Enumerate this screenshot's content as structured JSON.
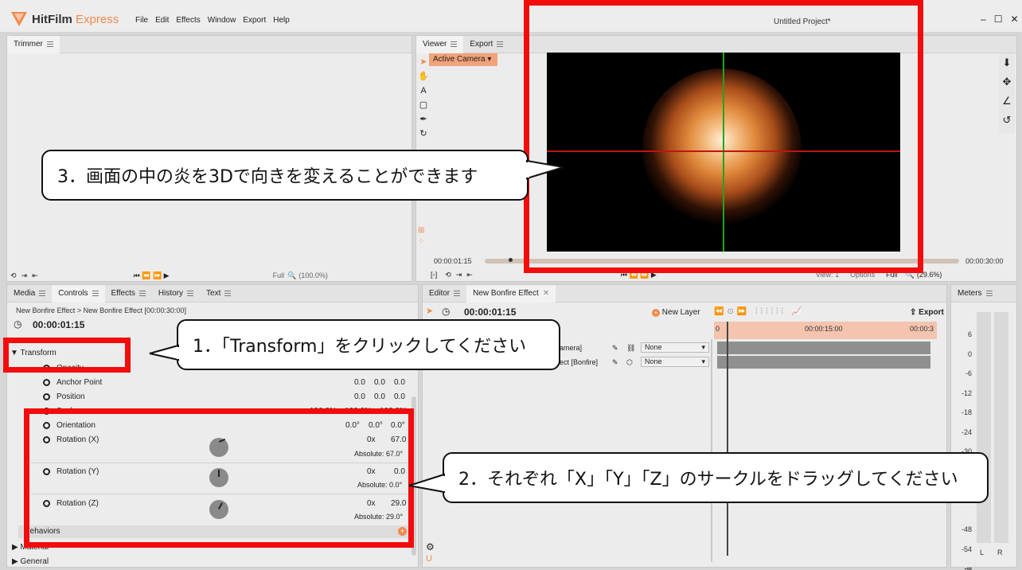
{
  "app": {
    "name": "HitFilm",
    "edition": "Express",
    "project_title": "Untitled Project*"
  },
  "menu": [
    "File",
    "Edit",
    "Effects",
    "Window",
    "Export",
    "Help"
  ],
  "window_controls": [
    "–",
    "☐",
    "✕"
  ],
  "trimmer": {
    "tab": "Trimmer",
    "zoom_mode": "Full",
    "zoom_pct": "(100.0%)"
  },
  "viewer": {
    "tabs": [
      "Viewer",
      "Export"
    ],
    "camera": "Active Camera",
    "timecode_start": "00:00:01:15",
    "timecode_end": "00:00:30:00",
    "view": "View: 1",
    "options": "Options",
    "quality": "Full",
    "zoom_pct": "(29.6%)"
  },
  "left_panel": {
    "tabs": [
      "Media",
      "Controls",
      "Effects",
      "History",
      "Text"
    ],
    "breadcrumb": "New Bonfire Effect > New Bonfire Effect [00:00:30:00]",
    "timecode": "00:00:01:15",
    "transform_label": "Transform",
    "props": {
      "opacity": "Opacity",
      "anchor": "Anchor Point",
      "anchor_vals": [
        "0.0",
        "0.0",
        "0.0"
      ],
      "position": "Position",
      "position_vals": [
        "0.0",
        "0.0",
        "0.0"
      ],
      "scale": "Scale",
      "scale_vals": [
        "100.0%",
        "100.0%",
        "100.0%"
      ],
      "orientation": "Orientation",
      "orientation_vals": [
        "0.0°",
        "0.0°",
        "0.0°"
      ],
      "rot_x": "Rotation (X)",
      "rot_x_turns": "0x",
      "rot_x_val": "67.0",
      "rot_x_abs": "Absolute: 67.0°",
      "rot_y": "Rotation (Y)",
      "rot_y_turns": "0x",
      "rot_y_val": "0.0",
      "rot_y_abs": "Absolute: 0.0°",
      "rot_z": "Rotation (Z)",
      "rot_z_turns": "0x",
      "rot_z_val": "29.0",
      "rot_z_abs": "Absolute: 29.0°"
    },
    "behaviors": "Behaviors",
    "material": "Material",
    "general": "General"
  },
  "editor": {
    "tabs": [
      "Editor",
      "New Bonfire Effect"
    ],
    "timecode": "00:00:01:15",
    "new_layer": "New Layer",
    "export": "Export",
    "ruler": [
      "0",
      "00:00:15:00",
      "00:00:3"
    ],
    "layers": [
      {
        "name": "amera]",
        "blend": "None"
      },
      {
        "name": "ect [Bonfire]",
        "blend": "None"
      }
    ]
  },
  "meters": {
    "tab": "Meters",
    "scale": [
      "6",
      "0",
      "-6",
      "-12",
      "-18",
      "-24",
      "-30",
      "-48",
      "-54",
      "-∞"
    ],
    "channels": [
      "L",
      "R"
    ]
  },
  "annotations": {
    "callout1": "1．「Transform」をクリックしてください",
    "callout2": "2．それぞれ「X」「Y」「Z」のサークルをドラッグしてください",
    "callout3": "3．画面の中の炎を3Dで向きを変えることができます"
  },
  "colors": {
    "accent": "#f08a4b",
    "highlight_red": "#f20c0c"
  }
}
